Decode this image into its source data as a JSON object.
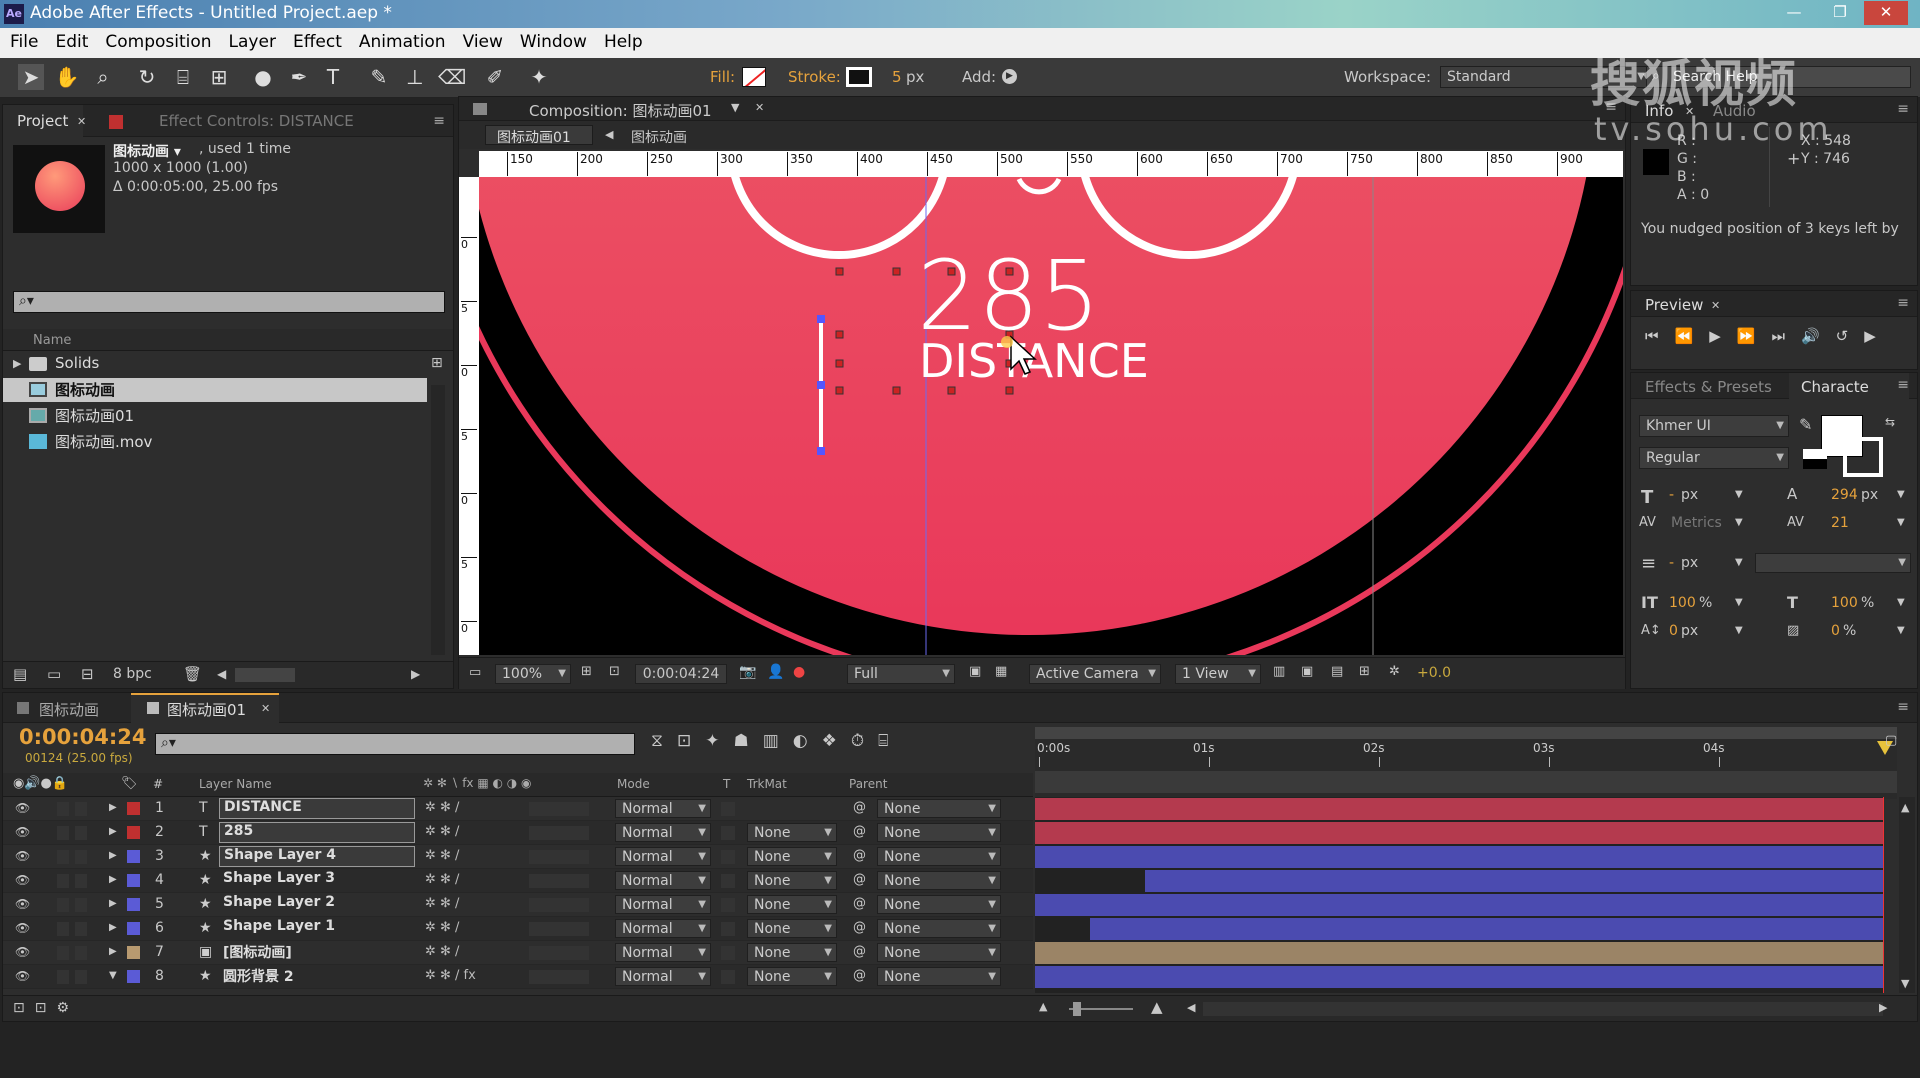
{
  "window": {
    "title": "Adobe After Effects - Untitled Project.aep *",
    "app_icon": "Ae"
  },
  "watermark": {
    "text": "搜狐视频",
    "url": "tv.sohu.com"
  },
  "menu": [
    "File",
    "Edit",
    "Composition",
    "Layer",
    "Effect",
    "Animation",
    "View",
    "Window",
    "Help"
  ],
  "toolbar": {
    "fill_label": "Fill:",
    "stroke_label": "Stroke:",
    "stroke_width": "5",
    "stroke_unit": "px",
    "add_label": "Add:",
    "workspace_label": "Workspace:",
    "workspace_value": "Standard",
    "search_placeholder": "Search Help"
  },
  "project_panel": {
    "tab_project": "Project",
    "tab_effect_controls": "Effect Controls: DISTANCE",
    "item_name": "图标动画 ▾",
    "item_used": ", used 1 time",
    "item_size": "1000 x 1000 (1.00)",
    "item_duration": "Δ 0:00:05:00, 25.00 fps",
    "column_name": "Name",
    "items": [
      {
        "name": "Solids",
        "type": "folder"
      },
      {
        "name": "图标动画",
        "type": "comp"
      },
      {
        "name": "图标动画01",
        "type": "comp"
      },
      {
        "name": "图标动画.mov",
        "type": "footage"
      }
    ],
    "bpc": "8 bpc"
  },
  "comp_panel": {
    "tab_label": "Composition: 图标动画01",
    "breadcrumb": [
      "图标动画01",
      "图标动画"
    ],
    "ruler_ticks": [
      "150",
      "200",
      "250",
      "300",
      "350",
      "400",
      "450",
      "500",
      "550",
      "600",
      "650",
      "700",
      "750",
      "800",
      "850",
      "900"
    ],
    "vruler_ticks": [
      "0",
      "5",
      "0",
      "5",
      "0",
      "5",
      "0"
    ],
    "text_number": "285",
    "text_label": "DISTANCE",
    "zoom": "100%",
    "timecode": "0:00:04:24",
    "resolution": "Full",
    "camera": "Active Camera",
    "view": "1 View",
    "exposure": "+0.0"
  },
  "info_panel": {
    "tab_info": "Info",
    "tab_audio": "Audio",
    "r": "R :",
    "g": "G :",
    "b": "B :",
    "a": "A : 0",
    "x": "X : 548",
    "y": "Y : 746",
    "message": "You nudged position of 3 keys left by"
  },
  "preview_panel": {
    "tab": "Preview"
  },
  "character_panel": {
    "tab_effects": "Effects & Presets",
    "tab_character": "Characte",
    "font": "Khmer UI",
    "style": "Regular",
    "size_value": "-",
    "size_unit": "px",
    "leading_value": "294",
    "leading_unit": "px",
    "kerning": "Metrics",
    "tracking": "21",
    "stroke_value": "-",
    "stroke_unit": "px",
    "vscale": "100",
    "hscale": "100",
    "pct": "%",
    "baseline": "0",
    "baseline_unit": "px",
    "tsume": "0",
    "tsume_unit": "%"
  },
  "timeline": {
    "tabs": [
      "图标动画",
      "图标动画01"
    ],
    "timecode": "0:00:04:24",
    "frame_info": "00124 (25.00 fps)",
    "time_markers": [
      "0:00s",
      "01s",
      "02s",
      "03s",
      "04s"
    ],
    "col_layer_name": "Layer Name",
    "col_mode": "Mode",
    "col_t": "T",
    "col_trkmat": "TrkMat",
    "col_parent": "Parent",
    "layers": [
      {
        "num": "1",
        "name": "DISTANCE",
        "type": "T",
        "mode": "Normal",
        "trkmat": "",
        "parent": "None",
        "color": "#c03030"
      },
      {
        "num": "2",
        "name": "285",
        "type": "T",
        "mode": "Normal",
        "trkmat": "None",
        "parent": "None",
        "color": "#c03030"
      },
      {
        "num": "3",
        "name": "Shape Layer 4",
        "type": "★",
        "mode": "Normal",
        "trkmat": "None",
        "parent": "None",
        "color": "#5b5bd6"
      },
      {
        "num": "4",
        "name": "Shape Layer 3",
        "type": "★",
        "mode": "Normal",
        "trkmat": "None",
        "parent": "None",
        "color": "#5b5bd6"
      },
      {
        "num": "5",
        "name": "Shape Layer 2",
        "type": "★",
        "mode": "Normal",
        "trkmat": "None",
        "parent": "None",
        "color": "#5b5bd6"
      },
      {
        "num": "6",
        "name": "Shape Layer 1",
        "type": "★",
        "mode": "Normal",
        "trkmat": "None",
        "parent": "None",
        "color": "#5b5bd6"
      },
      {
        "num": "7",
        "name": "[图标动画]",
        "type": "▣",
        "mode": "Normal",
        "trkmat": "None",
        "parent": "None",
        "color": "#b89a70"
      },
      {
        "num": "8",
        "name": "圆形背景 2",
        "type": "★",
        "mode": "Normal",
        "trkmat": "None",
        "parent": "None",
        "color": "#5b5bd6"
      }
    ]
  }
}
